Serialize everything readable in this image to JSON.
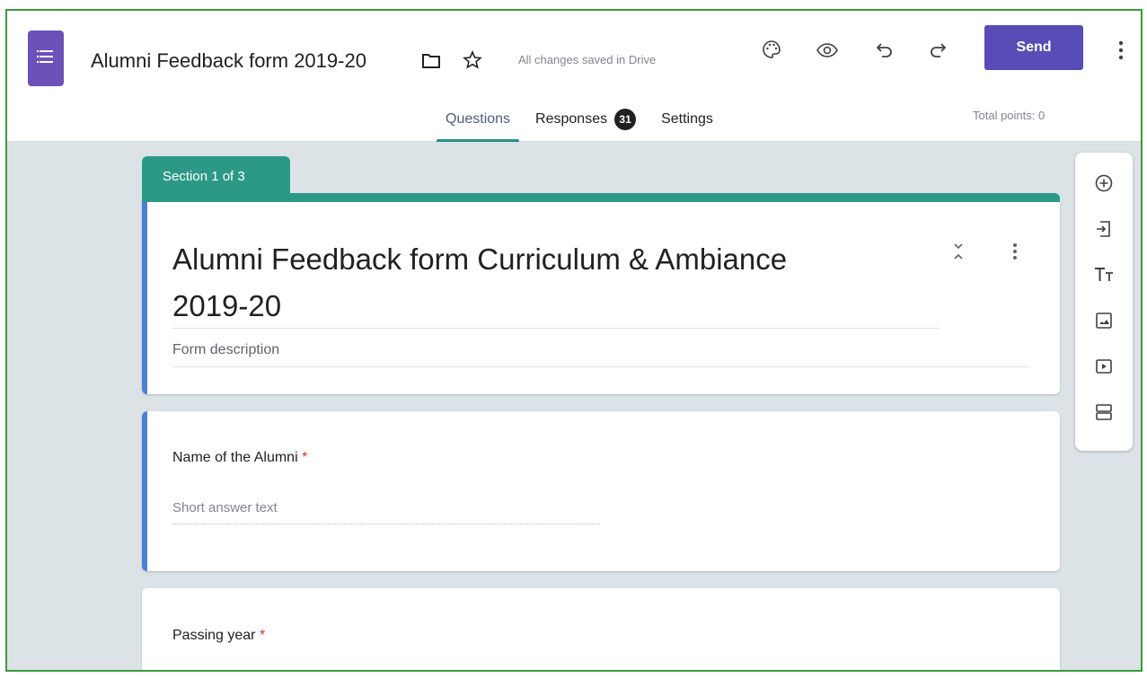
{
  "app": {
    "form_title": "Alumni Feedback form 2019-20",
    "save_status": "All changes saved in Drive",
    "send_label": "Send"
  },
  "tabs": [
    {
      "label": "Questions",
      "active": true
    },
    {
      "label": "Responses",
      "badge": "31"
    },
    {
      "label": "Settings"
    }
  ],
  "total_points": "Total points: 0",
  "section": {
    "label": "Section 1 of 3",
    "title": "Alumni Feedback form  Curriculum & Ambiance  2019-20",
    "description_placeholder": "Form description"
  },
  "questions": [
    {
      "label": "Name of the Alumni",
      "required_mark": "*",
      "answer_placeholder": "Short answer text"
    },
    {
      "label": "Passing year",
      "required_mark": "*"
    }
  ],
  "toolbar": {
    "icons": [
      "add-question-icon",
      "import-questions-icon",
      "add-title-icon",
      "add-image-icon",
      "add-video-icon",
      "add-section-icon"
    ]
  },
  "colors": {
    "accent": "#5a4cb6",
    "section": "#2c9987",
    "active_bar": "#4a7fd4",
    "background": "#dbe3e6"
  }
}
